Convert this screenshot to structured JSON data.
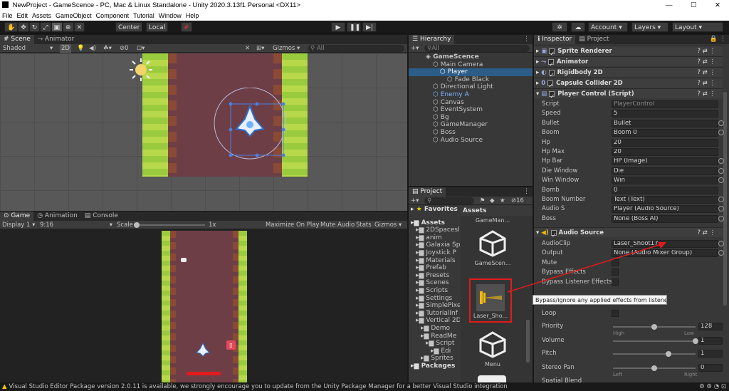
{
  "title": "NewProject - GameScence - PC, Mac & Linux Standalone - Unity 2020.3.13f1 Personal <DX11>",
  "menu": [
    "File",
    "Edit",
    "Assets",
    "GameObject",
    "Component",
    "Tutorial",
    "Window",
    "Help"
  ],
  "toolbar": {
    "center": "Center",
    "local": "Local",
    "account": "Account",
    "layers": "Layers",
    "layout": "Layout"
  },
  "scene": {
    "tab_scene": "Scene",
    "tab_animator": "Animator",
    "shaded": "Shaded",
    "mode2d": "2D",
    "gizmos": "Gizmos",
    "search": "All"
  },
  "game": {
    "tab_game": "Game",
    "tab_animation": "Animation",
    "tab_console": "Console",
    "display": "Display 1",
    "ratio": "9:16",
    "scale_label": "Scale",
    "scale_value": "1x",
    "maximize": "Maximize On Play",
    "mute": "Mute Audio",
    "stats": "Stats",
    "gizmos": "Gizmos"
  },
  "hierarchy": {
    "tab": "Hierarchy",
    "search": "All",
    "items": [
      {
        "label": "GameScence",
        "indent": 0
      },
      {
        "label": "Main Camera",
        "indent": 1
      },
      {
        "label": "Player",
        "indent": 2,
        "selected": true
      },
      {
        "label": "Fade Black",
        "indent": 3
      },
      {
        "label": "Directional Light",
        "indent": 1
      },
      {
        "label": "Enemy A",
        "indent": 1,
        "prefab": true
      },
      {
        "label": "Canvas",
        "indent": 1
      },
      {
        "label": "EventSystem",
        "indent": 1
      },
      {
        "label": "Bg",
        "indent": 1
      },
      {
        "label": "GameManager",
        "indent": 1
      },
      {
        "label": "Boss",
        "indent": 1
      },
      {
        "label": "Audio Source",
        "indent": 1
      }
    ]
  },
  "project": {
    "tab": "Project",
    "count": "16",
    "favorites": "Favorites",
    "assets_header": "Assets",
    "tree": [
      {
        "label": "Assets",
        "indent": 0,
        "bold": true
      },
      {
        "label": "2DSpacesl",
        "indent": 1
      },
      {
        "label": "anim",
        "indent": 1
      },
      {
        "label": "Galaxia Sp",
        "indent": 1
      },
      {
        "label": "Joystick P",
        "indent": 1
      },
      {
        "label": "Materials",
        "indent": 1
      },
      {
        "label": "Prefab",
        "indent": 1
      },
      {
        "label": "Presets",
        "indent": 1
      },
      {
        "label": "Scenes",
        "indent": 1
      },
      {
        "label": "Scripts",
        "indent": 1
      },
      {
        "label": "Settings",
        "indent": 1
      },
      {
        "label": "SimplePixe",
        "indent": 1
      },
      {
        "label": "TutorialInf",
        "indent": 1
      },
      {
        "label": "Vertical 2D",
        "indent": 1
      },
      {
        "label": "Demo",
        "indent": 2
      },
      {
        "label": "ReadMe",
        "indent": 2
      },
      {
        "label": "Script",
        "indent": 3
      },
      {
        "label": "Edi",
        "indent": 4
      },
      {
        "label": "Sprites",
        "indent": 2
      },
      {
        "label": "Packages",
        "indent": 0,
        "bold": true
      }
    ],
    "grid": [
      {
        "label": "GameMan..."
      },
      {
        "label": "GameScen..."
      },
      {
        "label": "Laser_Sho..."
      },
      {
        "label": "Menu"
      }
    ]
  },
  "inspector": {
    "tab_inspector": "Inspector",
    "tab_project": "Project",
    "components": [
      "Sprite Renderer",
      "Animator",
      "Rigidbody 2D",
      "Capsule Collider 2D",
      "Player Control (Script)"
    ],
    "fields": [
      {
        "label": "Script",
        "value": "PlayerControl"
      },
      {
        "label": "Speed",
        "value": "5"
      },
      {
        "label": "Bullet",
        "value": "Bullet"
      },
      {
        "label": "Boom",
        "value": "Boom 0"
      },
      {
        "label": "Hp",
        "value": "20"
      },
      {
        "label": "Hp Max",
        "value": "20"
      },
      {
        "label": "Hp Bar",
        "value": "HP (Image)"
      },
      {
        "label": "Die Window",
        "value": "Die"
      },
      {
        "label": "Win Window",
        "value": "Win"
      },
      {
        "label": "Bomb",
        "value": "0"
      },
      {
        "label": "Boom Number",
        "value": "Text (Text)"
      },
      {
        "label": "Audio S",
        "value": "Player (Audio Source)"
      },
      {
        "label": "Boss",
        "value": "None (Boss AI)"
      }
    ],
    "audio_source": "Audio Source",
    "audio_fields": [
      {
        "label": "AudioClip",
        "value": "Laser_Shoot17"
      },
      {
        "label": "Output",
        "value": "None (Audio Mixer Group)"
      },
      {
        "label": "Mute"
      },
      {
        "label": "Bypass Effects"
      },
      {
        "label": "Bypass Listener Effects"
      },
      {
        "label": "Loop"
      }
    ],
    "tooltip": "Bypass/ignore any applied effects from listener.",
    "sliders": [
      {
        "label": "Priority",
        "value": "128",
        "low": "High",
        "high": "Low",
        "fraction": 0.5
      },
      {
        "label": "Volume",
        "value": "1",
        "fraction": 1.0
      },
      {
        "label": "Pitch",
        "value": "1",
        "fraction": 0.67
      },
      {
        "label": "Stereo Pan",
        "value": "0",
        "low": "Left",
        "high": "Right",
        "fraction": 0.5
      },
      {
        "label": "Spatial Blend"
      }
    ]
  },
  "status": "Visual Studio Editor Package version 2.0.11 is available, we strongly encourage you to update from the Unity Package Manager for a better Visual Studio integration",
  "colors": {
    "accent": "#2c5d87",
    "selection": "#2c5d87",
    "red": "#e11b1b",
    "warning": "#f2c40f",
    "road": "#6e3e47",
    "grass": "#9acb3e"
  }
}
